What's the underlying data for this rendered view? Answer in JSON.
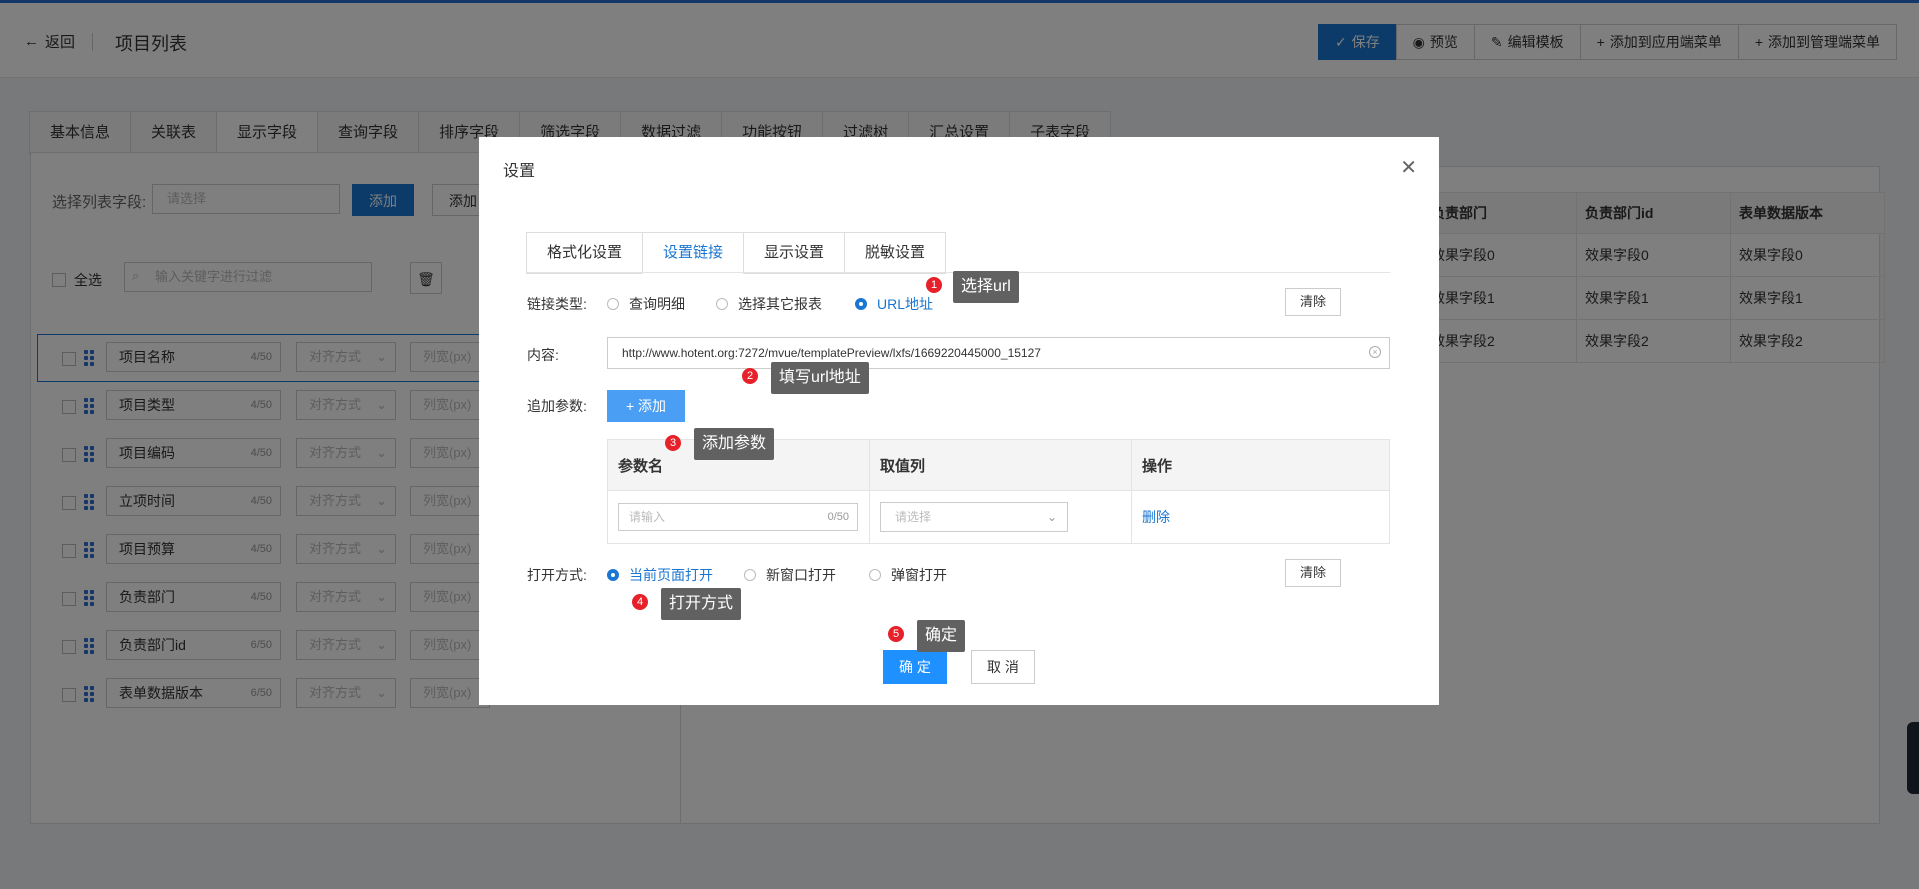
{
  "header": {
    "back_label": "返回",
    "page_title": "项目列表"
  },
  "toolbar": {
    "save": "保存",
    "preview": "预览",
    "edit_template": "编辑模板",
    "add_app_menu": "添加到应用端菜单",
    "add_admin_menu": "添加到管理端菜单"
  },
  "tabs": [
    "基本信息",
    "关联表",
    "显示字段",
    "查询字段",
    "排序字段",
    "筛选字段",
    "数据过滤",
    "功能按钮",
    "过滤树",
    "汇总设置",
    "子表字段"
  ],
  "left_panel": {
    "select_label": "选择列表字段:",
    "select_placeholder": "请选择",
    "add_button": "添加",
    "add_more": "添加",
    "select_all": "全选",
    "filter_placeholder": "输入关键字进行过滤",
    "align_placeholder": "对齐方式",
    "width_placeholder": "列宽(px)",
    "fields": [
      {
        "name": "项目名称",
        "count": "4/50"
      },
      {
        "name": "项目类型",
        "count": "4/50"
      },
      {
        "name": "项目编码",
        "count": "4/50"
      },
      {
        "name": "立项时间",
        "count": "4/50"
      },
      {
        "name": "项目预算",
        "count": "4/50"
      },
      {
        "name": "负责部门",
        "count": "4/50"
      },
      {
        "name": "负责部门id",
        "count": "6/50"
      },
      {
        "name": "表单数据版本",
        "count": "6/50"
      }
    ]
  },
  "preview_table": {
    "headers": [
      "负责部门",
      "负责部门id",
      "表单数据版本"
    ],
    "rows": [
      [
        "效果字段0",
        "效果字段0",
        "效果字段0"
      ],
      [
        "效果字段1",
        "效果字段1",
        "效果字段1"
      ],
      [
        "效果字段2",
        "效果字段2",
        "效果字段2"
      ]
    ]
  },
  "modal": {
    "title": "设置",
    "tabs": [
      "格式化设置",
      "设置链接",
      "显示设置",
      "脱敏设置"
    ],
    "link_type_label": "链接类型:",
    "link_type_options": [
      "查询明细",
      "选择其它报表",
      "URL地址"
    ],
    "clear_label": "清除",
    "content_label": "内容:",
    "url_value": "http://www.hotent.org:7272/mvue/templatePreview/lxfs/1669220445000_15127",
    "params_label": "追加参数:",
    "add_label": "添加",
    "param_headers": [
      "参数名",
      "取值列",
      "操作"
    ],
    "param_input_placeholder": "请输入",
    "param_input_count": "0/50",
    "param_select_placeholder": "请选择",
    "delete_label": "删除",
    "open_mode_label": "打开方式:",
    "open_mode_options": [
      "当前页面打开",
      "新窗口打开",
      "弹窗打开"
    ],
    "ok_label": "确 定",
    "cancel_label": "取 消"
  },
  "annotations": [
    {
      "num": "1",
      "text": "选择url"
    },
    {
      "num": "2",
      "text": "填写url地址"
    },
    {
      "num": "3",
      "text": "添加参数"
    },
    {
      "num": "4",
      "text": "打开方式"
    },
    {
      "num": "5",
      "text": "确定"
    }
  ]
}
